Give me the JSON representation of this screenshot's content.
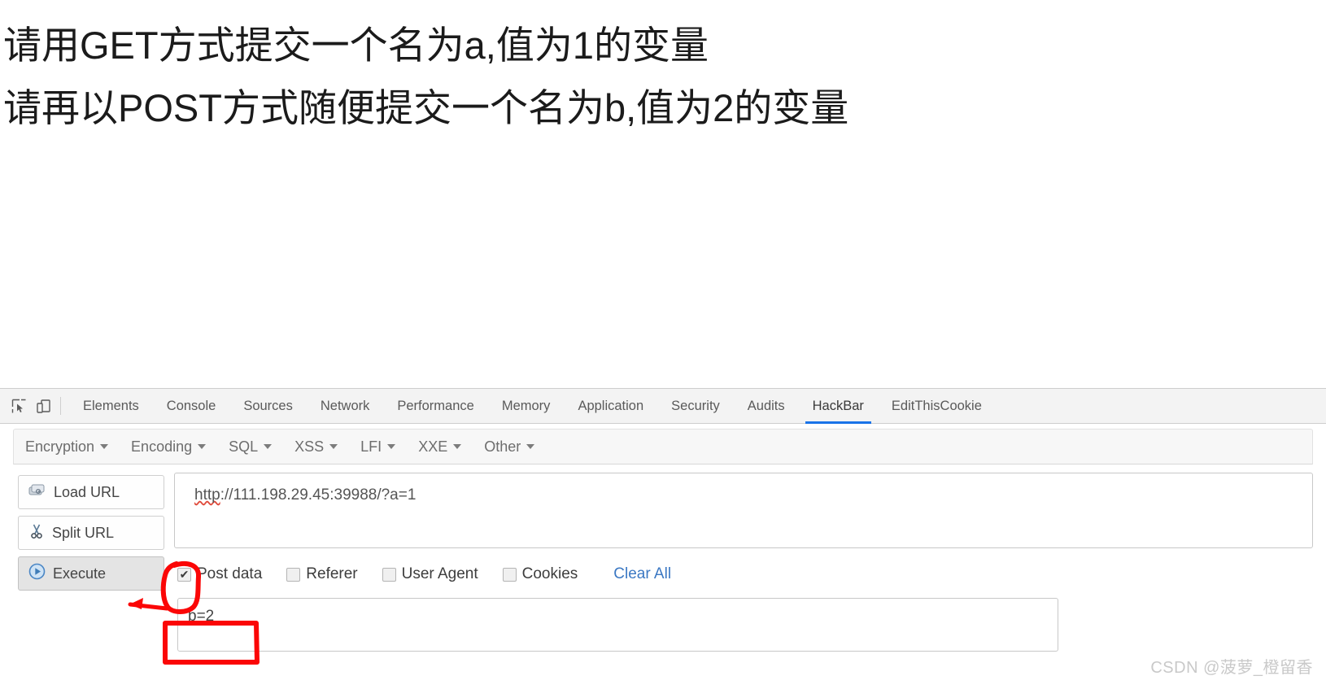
{
  "page": {
    "lines": [
      "请用GET方式提交一个名为a,值为1的变量",
      "请再以POST方式随便提交一个名为b,值为2的变量"
    ]
  },
  "devtools": {
    "icons": [
      {
        "name": "inspect-element-icon"
      },
      {
        "name": "device-toolbar-icon"
      }
    ],
    "tabs": [
      {
        "label": "Elements",
        "active": false
      },
      {
        "label": "Console",
        "active": false
      },
      {
        "label": "Sources",
        "active": false
      },
      {
        "label": "Network",
        "active": false
      },
      {
        "label": "Performance",
        "active": false
      },
      {
        "label": "Memory",
        "active": false
      },
      {
        "label": "Application",
        "active": false
      },
      {
        "label": "Security",
        "active": false
      },
      {
        "label": "Audits",
        "active": false
      },
      {
        "label": "HackBar",
        "active": true
      },
      {
        "label": "EditThisCookie",
        "active": false
      }
    ],
    "active_tab_color": "#1a73e8"
  },
  "hackbar": {
    "menu": [
      {
        "label": "Encryption"
      },
      {
        "label": "Encoding"
      },
      {
        "label": "SQL"
      },
      {
        "label": "XSS"
      },
      {
        "label": "LFI"
      },
      {
        "label": "XXE"
      },
      {
        "label": "Other"
      }
    ],
    "buttons": [
      {
        "label": "Load URL",
        "icon": "disk-drive-icon",
        "pressed": false
      },
      {
        "label": "Split URL",
        "icon": "scissors-icon",
        "pressed": false
      },
      {
        "label": "Execute",
        "icon": "play-circle-icon",
        "pressed": true
      }
    ],
    "url": {
      "value": "http://111.198.29.45:39988/?a=1",
      "misspelled_part": "http",
      "rest": "://111.198.29.45:39988/?a=1",
      "placeholder": ""
    },
    "options": [
      {
        "label": "Post data",
        "checked": true
      },
      {
        "label": "Referer",
        "checked": false
      },
      {
        "label": "User Agent",
        "checked": false
      },
      {
        "label": "Cookies",
        "checked": false
      }
    ],
    "clear_all_label": "Clear All",
    "clear_all_color": "#3b78c3",
    "post_data": {
      "value": "b=2",
      "placeholder": ""
    }
  },
  "annotations": {
    "color": "#fb0606",
    "circle_target": "post-data-checkbox",
    "arrow_target": "execute-button",
    "rect_target": "post-data-textarea"
  },
  "watermark": {
    "text": "CSDN @菠萝_橙留香"
  }
}
